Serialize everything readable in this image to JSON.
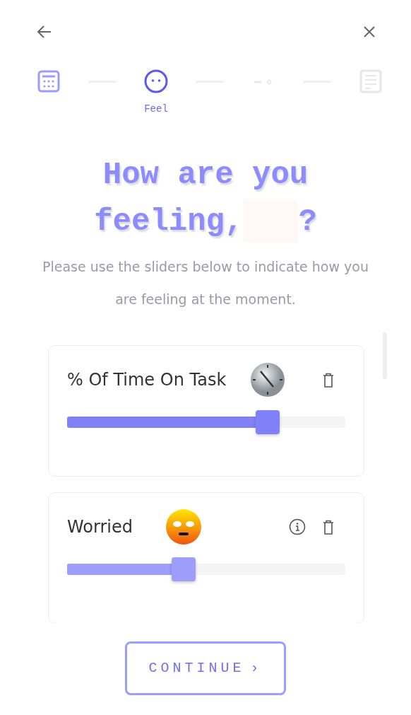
{
  "steps": [
    {
      "kind": "calendar",
      "selected": false
    },
    {
      "kind": "face",
      "selected": true,
      "label": "Feel"
    },
    {
      "kind": "pill",
      "selected": false
    },
    {
      "kind": "document",
      "selected": false
    }
  ],
  "title": {
    "line_1": "How are you",
    "line_2": "feeling,",
    "end": "?"
  },
  "subtitle": "Please use the sliders below to indicate how you are feeling at the moment.",
  "sliders": [
    {
      "name": "% Of Time On Task",
      "kind": "clock",
      "level": 0.72,
      "active": true,
      "info": false
    },
    {
      "name": "Worried",
      "kind": "worried",
      "level": 0.42,
      "active": false,
      "info": true
    }
  ],
  "continue_button": {
    "label": "CONTINUE",
    "arrow": "›"
  }
}
